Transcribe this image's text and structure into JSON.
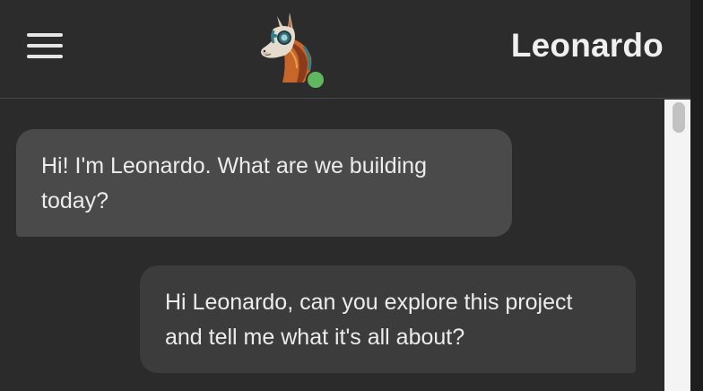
{
  "header": {
    "title": "Leonardo",
    "status": "online",
    "status_color": "#5fb85f",
    "menu_icon": "hamburger-menu-icon",
    "avatar_icon": "llama-avatar"
  },
  "chat": {
    "messages": [
      {
        "sender": "assistant",
        "text": "Hi! I'm Leonardo. What are we building today?"
      },
      {
        "sender": "user",
        "text": "Hi Leonardo, can you explore this project and tell me what it's all about?"
      }
    ]
  },
  "colors": {
    "background": "#2b2b2b",
    "assistant_bubble": "#4a4a4a",
    "user_bubble": "#3c3c3c",
    "text": "#ececec"
  }
}
